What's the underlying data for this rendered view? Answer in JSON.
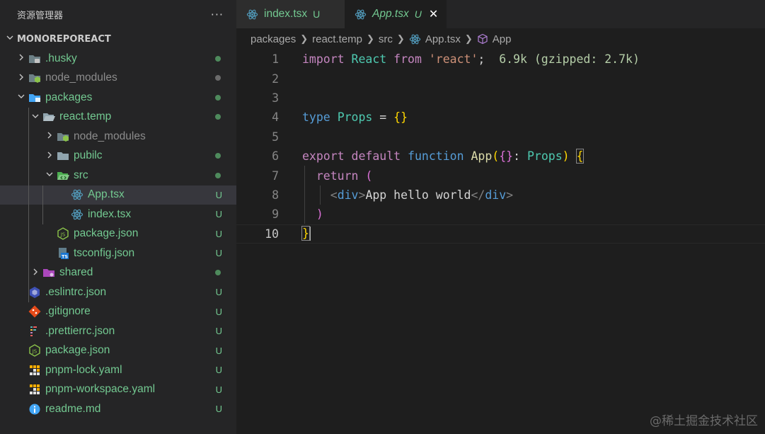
{
  "explorer": {
    "title": "资源管理器",
    "more": "···",
    "project": "MONOREPOREACT"
  },
  "tree": [
    {
      "label": ".husky",
      "color": "#73c991",
      "status": "dot",
      "statusColor": "#4e8a5c",
      "icon": "husky-folder-icon",
      "depth": 0,
      "chevron": "right"
    },
    {
      "label": "node_modules",
      "color": "#8c8c8c",
      "status": "dot",
      "statusColor": "#6b6b6b",
      "icon": "node-folder-icon",
      "depth": 0,
      "chevron": "right"
    },
    {
      "label": "packages",
      "color": "#73c991",
      "status": "dot",
      "statusColor": "#4e8a5c",
      "icon": "packages-folder-icon",
      "depth": 0,
      "chevron": "down"
    },
    {
      "label": "react.temp",
      "color": "#73c991",
      "status": "dot",
      "statusColor": "#4e8a5c",
      "icon": "folder-open-icon",
      "depth": 1,
      "chevron": "down"
    },
    {
      "label": "node_modules",
      "color": "#8c8c8c",
      "status": "",
      "statusColor": "",
      "icon": "node-folder-icon",
      "depth": 2,
      "chevron": "right"
    },
    {
      "label": "pubilc",
      "color": "#73c991",
      "status": "dot",
      "statusColor": "#4e8a5c",
      "icon": "folder-icon",
      "depth": 2,
      "chevron": "right"
    },
    {
      "label": "src",
      "color": "#73c991",
      "status": "dot",
      "statusColor": "#4e8a5c",
      "icon": "src-folder-icon",
      "depth": 2,
      "chevron": "down"
    },
    {
      "label": "App.tsx",
      "color": "#73c991",
      "status": "U",
      "statusColor": "#73c991",
      "icon": "react-icon",
      "depth": 3,
      "chevron": "",
      "selected": true
    },
    {
      "label": "index.tsx",
      "color": "#73c991",
      "status": "U",
      "statusColor": "#73c991",
      "icon": "react-icon",
      "depth": 3,
      "chevron": ""
    },
    {
      "label": "package.json",
      "color": "#73c991",
      "status": "U",
      "statusColor": "#73c991",
      "icon": "nodejs-icon",
      "depth": 2,
      "chevron": ""
    },
    {
      "label": "tsconfig.json",
      "color": "#73c991",
      "status": "U",
      "statusColor": "#73c991",
      "icon": "tsconfig-icon",
      "depth": 2,
      "chevron": ""
    },
    {
      "label": "shared",
      "color": "#73c991",
      "status": "dot",
      "statusColor": "#4e8a5c",
      "icon": "shared-folder-icon",
      "depth": 1,
      "chevron": "right"
    },
    {
      "label": ".eslintrc.json",
      "color": "#73c991",
      "status": "U",
      "statusColor": "#73c991",
      "icon": "eslint-icon",
      "depth": 0,
      "chevron": ""
    },
    {
      "label": ".gitignore",
      "color": "#73c991",
      "status": "U",
      "statusColor": "#73c991",
      "icon": "git-icon",
      "depth": 0,
      "chevron": ""
    },
    {
      "label": ".prettierrc.json",
      "color": "#73c991",
      "status": "U",
      "statusColor": "#73c991",
      "icon": "prettier-icon",
      "depth": 0,
      "chevron": ""
    },
    {
      "label": "package.json",
      "color": "#73c991",
      "status": "U",
      "statusColor": "#73c991",
      "icon": "nodejs-icon",
      "depth": 0,
      "chevron": ""
    },
    {
      "label": "pnpm-lock.yaml",
      "color": "#73c991",
      "status": "U",
      "statusColor": "#73c991",
      "icon": "pnpm-icon",
      "depth": 0,
      "chevron": ""
    },
    {
      "label": "pnpm-workspace.yaml",
      "color": "#73c991",
      "status": "U",
      "statusColor": "#73c991",
      "icon": "pnpm-icon",
      "depth": 0,
      "chevron": ""
    },
    {
      "label": "readme.md",
      "color": "#73c991",
      "status": "U",
      "statusColor": "#73c991",
      "icon": "info-icon",
      "depth": 0,
      "chevron": ""
    }
  ],
  "tabs": [
    {
      "label": "index.tsx",
      "status": "U",
      "active": false
    },
    {
      "label": "App.tsx",
      "status": "U",
      "active": true,
      "close": "✕"
    }
  ],
  "breadcrumb": {
    "parts": [
      "packages",
      "react.temp",
      "src"
    ],
    "file": "App.tsx",
    "symbol": "App"
  },
  "code": {
    "line_numbers": [
      "1",
      "2",
      "3",
      "4",
      "5",
      "6",
      "7",
      "8",
      "9",
      "10"
    ],
    "current_line": 10,
    "l1_import": "import",
    "l1_react": "React",
    "l1_from": "from",
    "l1_str": "'react'",
    "l1_semi": ";",
    "l1_hint": "6.9k (gzipped: 2.7k)",
    "l4_type": "type",
    "l4_name": "Props",
    "l4_eq": " = ",
    "l4_obj": "{}",
    "l6_export": "export",
    "l6_default": "default",
    "l6_function": "function",
    "l6_name": "App",
    "l6_paren_open": "(",
    "l6_destruct": "{}",
    "l6_colon": ": ",
    "l6_type": "Props",
    "l6_paren_close": ")",
    "l6_brace": "{",
    "l7_return": "return",
    "l7_paren": "(",
    "l8_lt": "<",
    "l8_tag": "div",
    "l8_gt": ">",
    "l8_text": "App hello world",
    "l8_lt2": "</",
    "l8_tag2": "div",
    "l8_gt2": ">",
    "l9_paren": ")",
    "l10_brace": "}"
  },
  "watermark": "@稀土掘金技术社区",
  "colors": {
    "untracked": "#73c991",
    "ignored": "#8c8c8c",
    "accent_react": "#519aba"
  }
}
